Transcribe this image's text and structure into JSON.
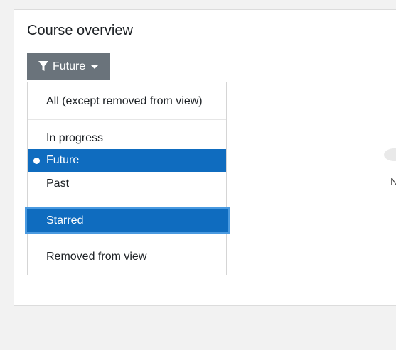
{
  "card": {
    "title": "Course overview"
  },
  "filter": {
    "selected_label": "Future",
    "icon": "filter-icon"
  },
  "menu": {
    "items": [
      {
        "label": "All (except removed from view)"
      },
      {
        "label": "In progress"
      },
      {
        "label": "Future",
        "state": "selected"
      },
      {
        "label": "Past"
      },
      {
        "label": "Starred",
        "state": "focused"
      },
      {
        "label": "Removed from view"
      }
    ]
  },
  "side": {
    "partial_text": "N"
  },
  "colors": {
    "button_bg": "#6a737b",
    "active_bg": "#0f6cbf",
    "focus_ring": "#4a9ae0",
    "page_bg": "#f2f2f2"
  }
}
